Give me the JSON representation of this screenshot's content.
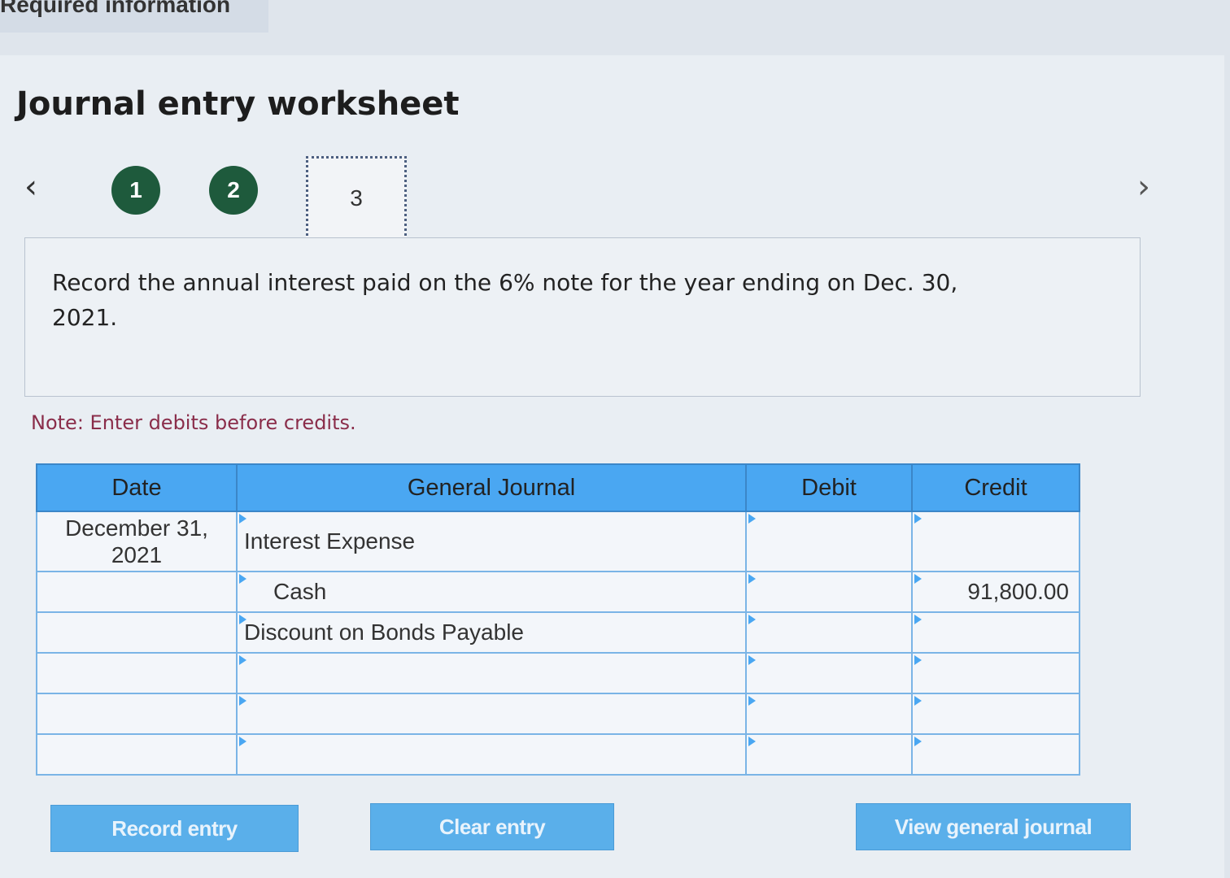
{
  "header": {
    "required_info": "Required information"
  },
  "worksheet": {
    "title": "Journal entry worksheet",
    "steps": [
      "1",
      "2",
      "3"
    ],
    "current_step": "3",
    "prompt": "Record the annual interest paid on the 6% note for the year ending on Dec. 30, 2021.",
    "note": "Note: Enter debits before credits."
  },
  "table": {
    "headers": {
      "date": "Date",
      "journal": "General Journal",
      "debit": "Debit",
      "credit": "Credit"
    },
    "rows": [
      {
        "date": "December 31, 2021",
        "account": "Interest Expense",
        "debit": "",
        "credit": ""
      },
      {
        "date": "",
        "account": "Cash",
        "debit": "",
        "credit": "91,800.00"
      },
      {
        "date": "",
        "account": "Discount on Bonds Payable",
        "debit": "",
        "credit": ""
      },
      {
        "date": "",
        "account": "",
        "debit": "",
        "credit": ""
      },
      {
        "date": "",
        "account": "",
        "debit": "",
        "credit": ""
      },
      {
        "date": "",
        "account": "",
        "debit": "",
        "credit": ""
      }
    ]
  },
  "buttons": {
    "record": "Record entry",
    "clear": "Clear entry",
    "view": "View general journal"
  },
  "colors": {
    "header_blue": "#4aa7f2",
    "step_green": "#1e5a3c",
    "button_blue": "#5aafea",
    "note_color": "#8a2d4a"
  }
}
